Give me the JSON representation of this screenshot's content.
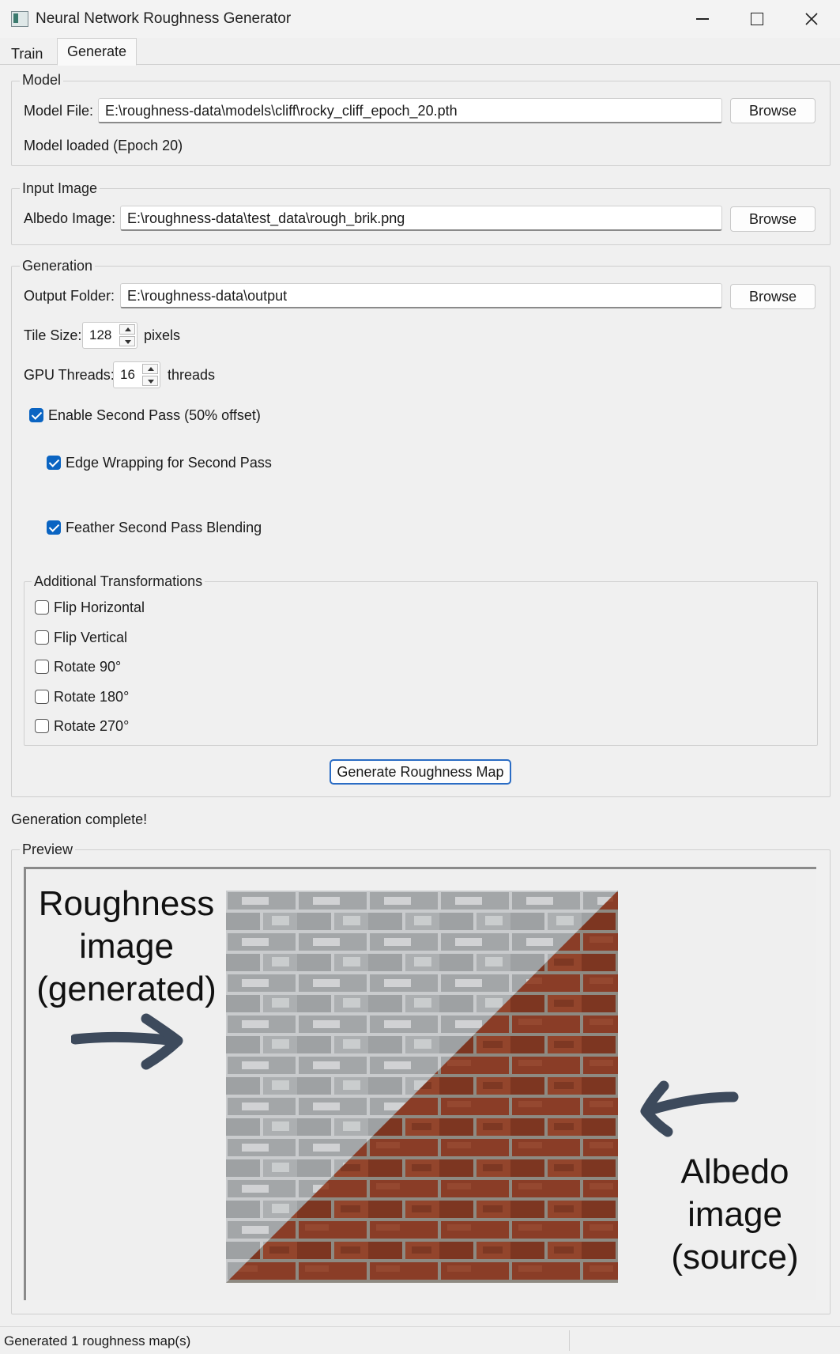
{
  "window": {
    "title": "Neural Network Roughness Generator"
  },
  "tabs": [
    {
      "label": "Train"
    },
    {
      "label": "Generate"
    }
  ],
  "model_group": {
    "legend": "Model",
    "file_label": "Model File:",
    "file_value": "E:\\roughness-data\\models\\cliff\\rocky_cliff_epoch_20.pth",
    "browse": "Browse",
    "status": "Model loaded (Epoch 20)"
  },
  "input_group": {
    "legend": "Input Image",
    "albedo_label": "Albedo Image:",
    "albedo_value": "E:\\roughness-data\\test_data\\rough_brik.png",
    "browse": "Browse"
  },
  "generation_group": {
    "legend": "Generation",
    "output_label": "Output Folder:",
    "output_value": "E:\\roughness-data\\output",
    "browse": "Browse",
    "tile_label": "Tile Size:",
    "tile_value": "128",
    "tile_unit": "pixels",
    "gpu_label": "GPU Threads:",
    "gpu_value": "16",
    "gpu_unit": "threads",
    "second_pass": {
      "label": "Enable Second Pass (50% offset)",
      "checked": true
    },
    "edge_wrapping": {
      "label": "Edge Wrapping for Second Pass",
      "checked": true
    },
    "feather": {
      "label": "Feather Second Pass Blending",
      "checked": true
    },
    "transforms": {
      "legend": "Additional Transformations",
      "items": [
        {
          "label": "Flip Horizontal",
          "checked": false
        },
        {
          "label": "Flip Vertical",
          "checked": false
        },
        {
          "label": "Rotate 90°",
          "checked": false
        },
        {
          "label": "Rotate 180°",
          "checked": false
        },
        {
          "label": "Rotate 270°",
          "checked": false
        }
      ]
    },
    "generate_button": "Generate Roughness Map"
  },
  "completion_message": "Generation complete!",
  "preview": {
    "legend": "Preview",
    "annotation_left": [
      "Roughness",
      "image",
      "(generated)"
    ],
    "annotation_right": [
      "Albedo",
      "image",
      "(source)"
    ]
  },
  "status_bar": {
    "text": "Generated 1 roughness map(s)"
  },
  "colors": {
    "accent": "#0a64c2",
    "arrow": "#3d4a5c",
    "brick": "#8a3a24",
    "mortar": "#9a9a94",
    "rough_gray": "#a8aaac"
  }
}
